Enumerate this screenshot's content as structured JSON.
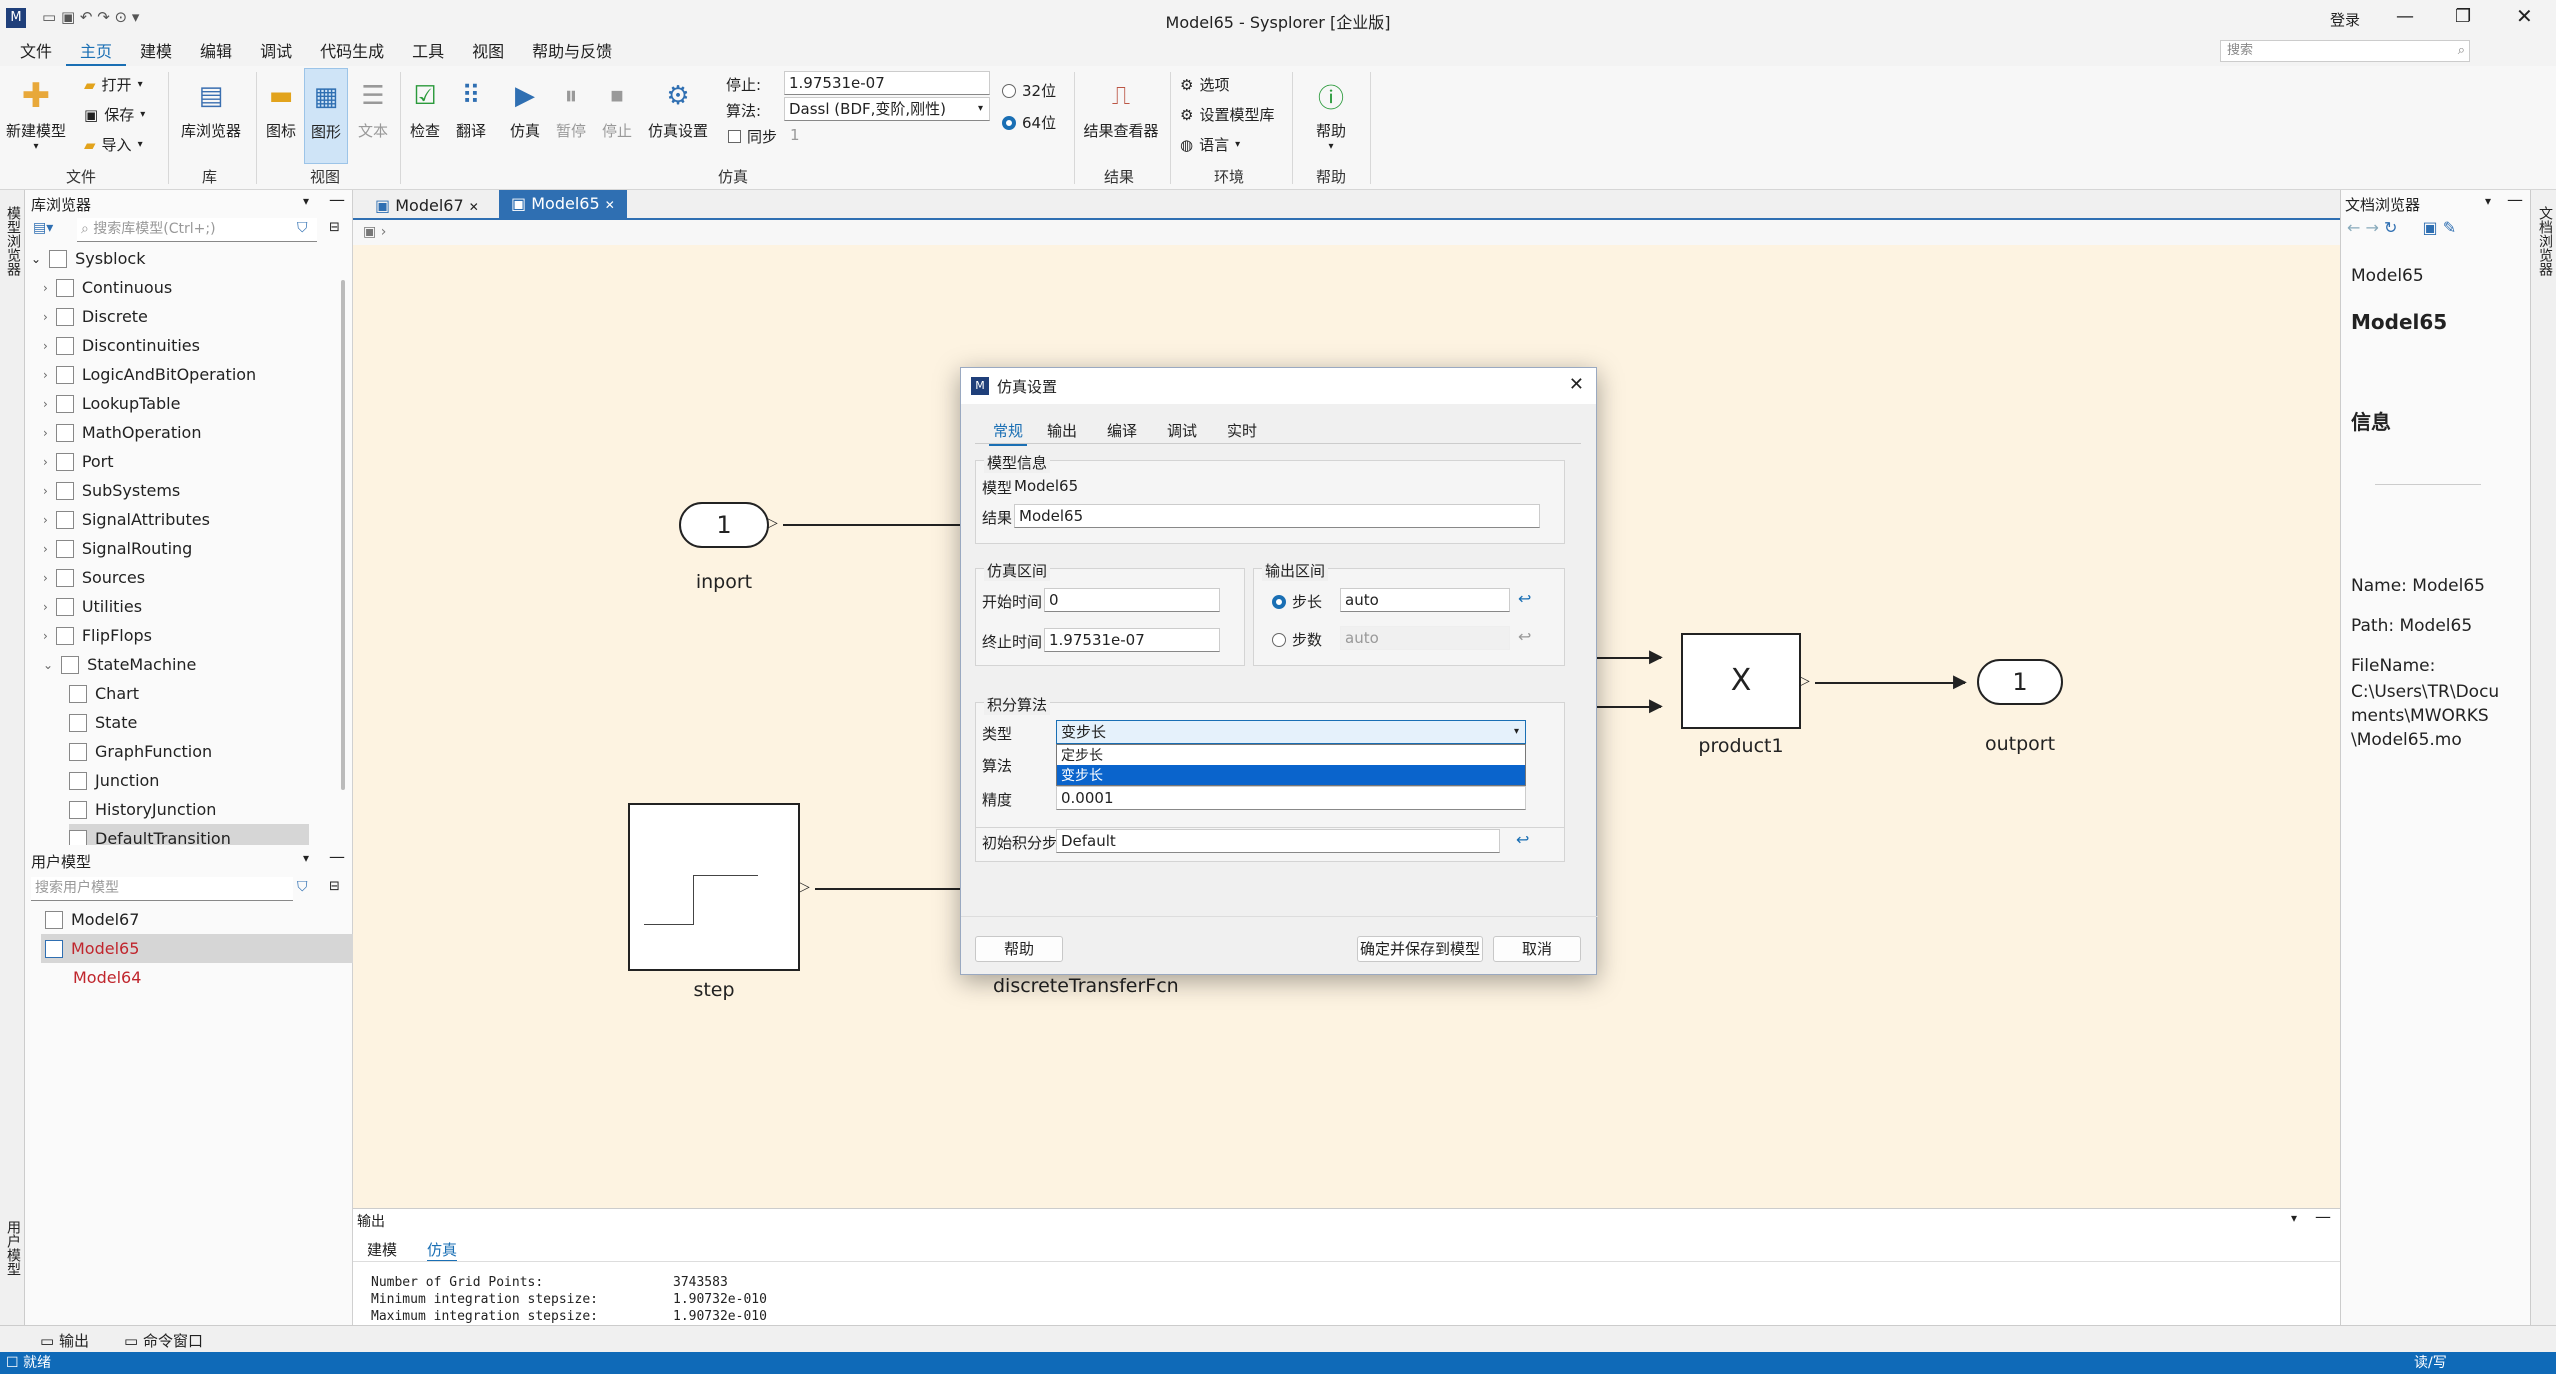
{
  "app": {
    "title": "Model65 - Sysplorer [企业版]",
    "login": "登录",
    "search_placeholder": "搜索"
  },
  "menu": [
    "文件",
    "主页",
    "建模",
    "编辑",
    "调试",
    "代码生成",
    "工具",
    "视图",
    "帮助与反馈"
  ],
  "ribbon": {
    "new_model": "新建模型",
    "open": "打开",
    "save": "保存",
    "import": "导入",
    "file_group": "文件",
    "lib_browser": "库浏览器",
    "lib_group": "库",
    "icon": "图标",
    "diagram": "图形",
    "text": "文本",
    "view_group": "视图",
    "check": "检查",
    "translate": "翻译",
    "simulate": "仿真",
    "pause": "暂停",
    "stop": "停止",
    "sim_settings": "仿真设置",
    "stop_label": "停止:",
    "stop_value": "1.97531e-07",
    "algo_label": "算法:",
    "algo_value": "Dassl (BDF,变阶,刚性)",
    "sync_label": "同步",
    "sync_value": "1",
    "bit32": "32位",
    "bit64": "64位",
    "sim_group": "仿真",
    "result_viewer": "结果查看器",
    "result_group": "结果",
    "options": "选项",
    "set_lib": "设置模型库",
    "language": "语言",
    "env_group": "环境",
    "help": "帮助",
    "help_group": "帮助"
  },
  "lib_browser": {
    "title": "库浏览器",
    "search_placeholder": "搜索库模型(Ctrl+;)",
    "root": "Sysblock",
    "items": [
      "Continuous",
      "Discrete",
      "Discontinuities",
      "LogicAndBitOperation",
      "LookupTable",
      "MathOperation",
      "Port",
      "SubSystems",
      "SignalAttributes",
      "SignalRouting",
      "Sources",
      "Utilities",
      "FlipFlops",
      "StateMachine"
    ],
    "sm_children": [
      "Chart",
      "State",
      "GraphFunction",
      "Junction",
      "HistoryJunction",
      "DefaultTransition"
    ]
  },
  "user_models": {
    "title": "用户模型",
    "search_placeholder": "搜索用户模型",
    "items": [
      "Model67",
      "Model65",
      "Model64"
    ]
  },
  "side_left_top": "模型浏览器",
  "side_left_bottom": "用户模型",
  "side_right": "文档浏览器",
  "tabs": [
    "Model67",
    "Model65"
  ],
  "diagram": {
    "inport_val": "1",
    "inport": "inport",
    "step": "step",
    "dtf": "discreteTransferFcn",
    "product": "product1",
    "product_sym": "X",
    "outport_val": "1",
    "outport": "outport"
  },
  "dialog": {
    "title": "仿真设置",
    "tabs": [
      "常规",
      "输出",
      "编译",
      "调试",
      "实时"
    ],
    "model_info": "模型信息",
    "model_label": "模型",
    "model_value": "Model65",
    "result_label": "结果",
    "result_value": "Model65",
    "sim_interval": "仿真区间",
    "start_label": "开始时间",
    "start_value": "0",
    "end_label": "终止时间",
    "end_value": "1.97531e-07",
    "out_interval": "输出区间",
    "step_label": "步长",
    "step_value": "auto",
    "steps_label": "步数",
    "steps_value": "auto",
    "integ": "积分算法",
    "type_label": "类型",
    "type_value": "变步长",
    "options": [
      "定步长",
      "变步长"
    ],
    "algo_label": "算法",
    "prec_label": "精度",
    "prec_value": "0.0001",
    "init_step_label": "初始积分步长",
    "init_step_value": "Default",
    "help_btn": "帮助",
    "ok_btn": "确定并保存到模型",
    "cancel_btn": "取消"
  },
  "output": {
    "title": "输出",
    "tabs": [
      "建模",
      "仿真"
    ],
    "lines": [
      {
        "k": "Number of Grid Points:",
        "v": "3743583"
      },
      {
        "k": "Minimum integration stepsize:",
        "v": "1.90732e-010"
      },
      {
        "k": "Maximum integration stepsize:",
        "v": "1.90732e-010"
      }
    ]
  },
  "doc": {
    "title": "文档浏览器",
    "name_small": "Model65",
    "name_big": "Model65",
    "info": "信息",
    "name_line": "Name: Model65",
    "path_line": "Path: Model65",
    "file_label": "FileName:",
    "file_value": "C:\\Users\\TR\\Documents\\MWORKS\\Model65.mo"
  },
  "bottom_tabs": [
    "输出",
    "命令窗口"
  ],
  "status": {
    "left": "就绪",
    "right": "读/写"
  }
}
